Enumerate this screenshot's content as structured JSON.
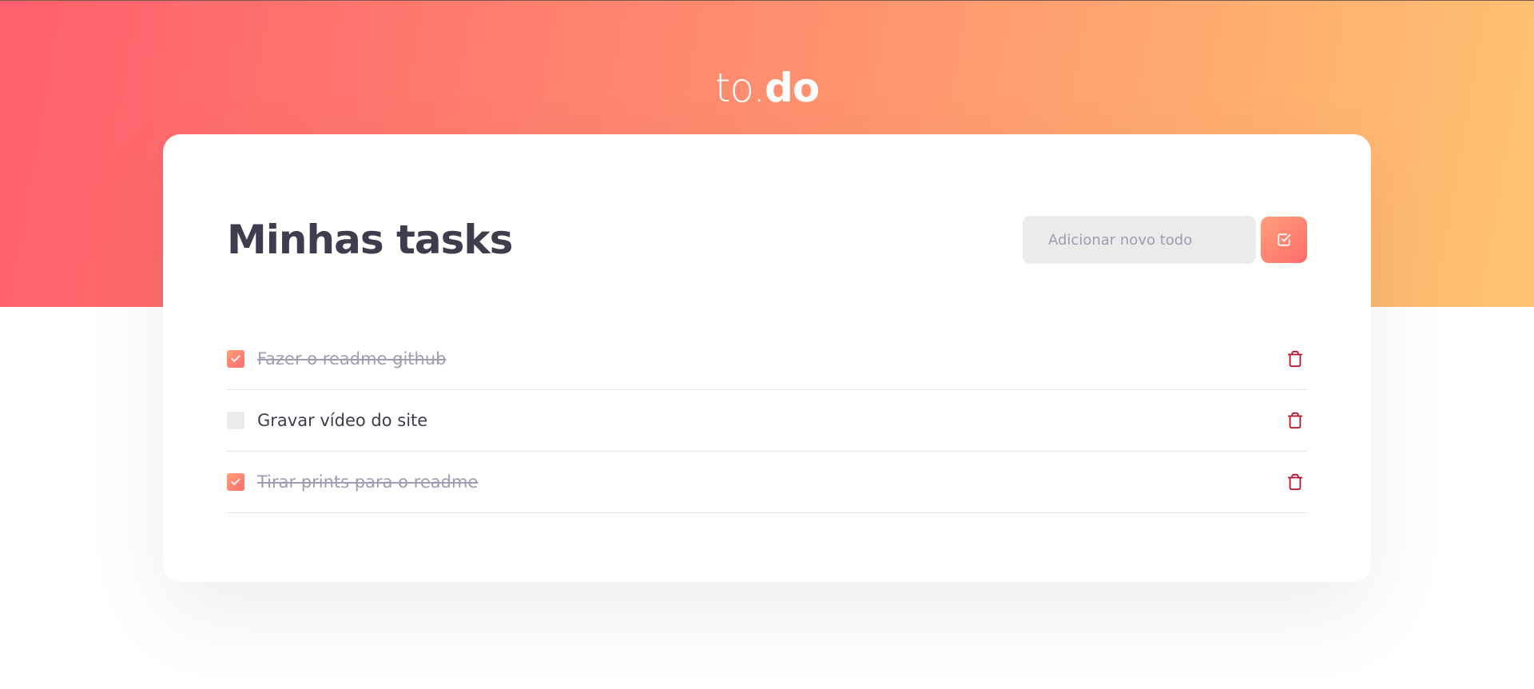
{
  "header": {
    "logo_light": "to.",
    "logo_bold": "do"
  },
  "main": {
    "title": "Minhas tasks",
    "add_input": {
      "value": "",
      "placeholder": "Adicionar novo todo"
    },
    "add_button_icon": "check-square-icon",
    "tasks": [
      {
        "text": "Fazer o readme github",
        "done": true
      },
      {
        "text": "Gravar vídeo do site",
        "done": false
      },
      {
        "text": "Tirar prints para o readme",
        "done": true
      }
    ],
    "delete_icon": "trash-icon"
  },
  "colors": {
    "gradient_start": "#ff5f6d",
    "gradient_end": "#ffc371",
    "title": "#3d3d4d",
    "muted": "#a09cb1",
    "delete": "#b2162f"
  }
}
